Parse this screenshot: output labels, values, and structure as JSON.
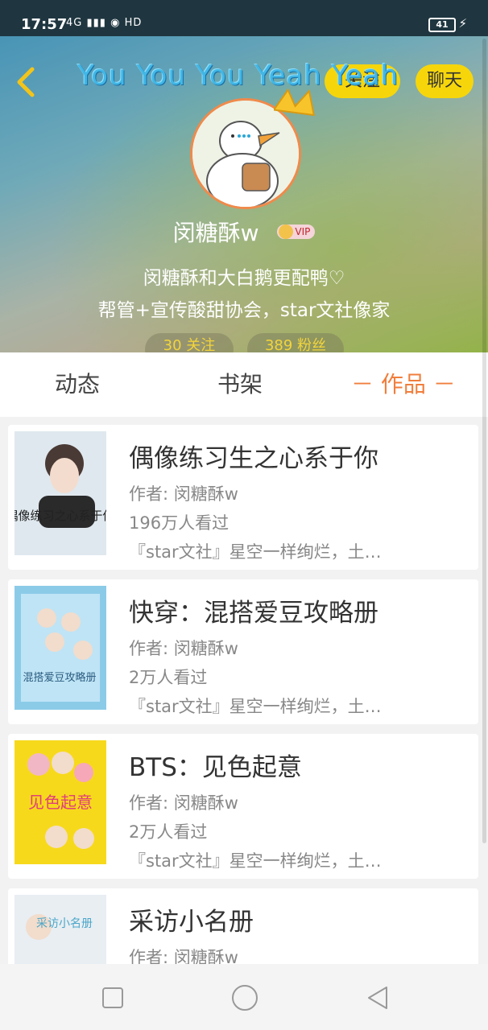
{
  "status_bar": {
    "time": "17:57",
    "signal": "4G",
    "hd": "HD",
    "battery": "41"
  },
  "header": {
    "song_title": "You You You Yeah Yeah",
    "follow_label": "关注",
    "chat_label": "聊天",
    "username": "闵糖酥w",
    "vip_label": "VIP",
    "bio_line1": "闵糖酥和大白鹅更配鸭♡",
    "bio_line2": "帮管+宣传酸甜协会，star文社像家",
    "following_count_label": "30 关注",
    "fans_count_label": "389 粉丝"
  },
  "tabs": {
    "dynamics": "动态",
    "shelf": "书架",
    "works": "－ 作品 －"
  },
  "works": [
    {
      "title": "偶像练习生之心系于你",
      "author": "作者: 闵糖酥w",
      "views": "196万人看过",
      "desc": "『star文社』星空一样绚烂，土…",
      "cover_text": "偶像练习之心系于你",
      "cover_color": "#dfe8ee"
    },
    {
      "title": "快穿：混搭爱豆攻略册",
      "author": "作者: 闵糖酥w",
      "views": "2万人看过",
      "desc": "『star文社』星空一样绚烂，土…",
      "cover_text": "混搭爱豆攻略册",
      "cover_color": "#8ccbe8"
    },
    {
      "title": "BTS：见色起意",
      "author": "作者: 闵糖酥w",
      "views": "2万人看过",
      "desc": "『star文社』星空一样绚烂，土…",
      "cover_text": "见色起意",
      "cover_color": "#f7d91c"
    },
    {
      "title": "采访小名册",
      "author": "作者: 闵糖酥w",
      "views": "",
      "desc": "",
      "cover_text": "采访小名册",
      "cover_color": "#e8eef2"
    }
  ],
  "icons": {
    "back": "chevron-left-icon",
    "crown": "crown-icon",
    "nav_recent": "square-icon",
    "nav_home": "circle-icon",
    "nav_back": "triangle-back-icon"
  },
  "colors": {
    "accent_orange": "#f07e3c",
    "button_yellow": "#f6d60b"
  }
}
